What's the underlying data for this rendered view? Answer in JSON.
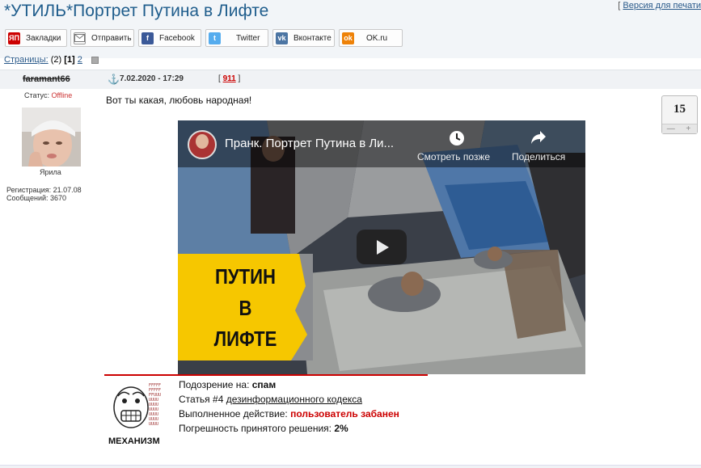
{
  "page": {
    "title": "*УТИЛЬ*Портрет Путина в Лифте",
    "print_prefix": "[ ",
    "print_label": "Версия для печати"
  },
  "share": [
    {
      "label": "Закладки",
      "icon": "yandex-bookmarks-icon",
      "icon_text": "ЯП",
      "color": "#cc0000"
    },
    {
      "label": "Отправить",
      "icon": "envelope-icon",
      "icon_text": "",
      "color": "#ffffff"
    },
    {
      "label": "Facebook",
      "icon": "facebook-icon",
      "icon_text": "f",
      "color": "#3b5998"
    },
    {
      "label": "Twitter",
      "icon": "twitter-icon",
      "icon_text": "t",
      "color": "#55acee"
    },
    {
      "label": "Вконтакте",
      "icon": "vk-icon",
      "icon_text": "vk",
      "color": "#4c75a3"
    },
    {
      "label": "OK.ru",
      "icon": "odnoklassniki-icon",
      "icon_text": "ok",
      "color": "#ee8208"
    }
  ],
  "pagination": {
    "label": "Страницы:",
    "count": "(2)",
    "current": "[1]",
    "next": "2"
  },
  "post": {
    "author": "faramant66",
    "date": "7.02.2020 - 17:29",
    "number_open": "[ ",
    "number": "911",
    "number_close": " ]",
    "text": "Вот ты какая, любовь народная!",
    "rating": "15",
    "rating_minus": "—",
    "rating_plus": "+"
  },
  "user": {
    "status_label": "Статус: ",
    "status_value": "Offline",
    "group": "Ярила",
    "registration": "Регистрация: 21.07.08",
    "messages": "Сообщений: 3670"
  },
  "video": {
    "title": "Пранк. Портрет Путина в Ли...",
    "watch_later": "Смотреть позже",
    "share": "Поделиться",
    "thumb_line1": "ПУТИН",
    "thumb_line2": "В",
    "thumb_line3": "ЛИФТЕ"
  },
  "moderation": {
    "name": "МЕХАНИЗМ",
    "line1_label": "Подозрение на: ",
    "line1_value": "спам",
    "line2_label": "Статья #4 ",
    "line2_link": "дезинформационного кодекса",
    "line3_label": "Выполненное действие: ",
    "line3_value": "пользователь забанен",
    "line4_label": "Погрешность принятого решения: ",
    "line4_value": "2%"
  }
}
